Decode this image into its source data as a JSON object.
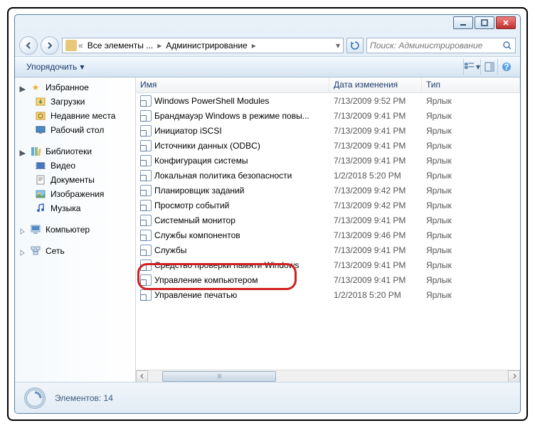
{
  "breadcrumb": {
    "segment1": "Все элементы ...",
    "segment2": "Администрирование"
  },
  "search": {
    "placeholder": "Поиск: Администрирование"
  },
  "toolbar": {
    "organize": "Упорядочить"
  },
  "sidebar": {
    "favorites": {
      "label": "Избранное",
      "items": [
        "Загрузки",
        "Недавние места",
        "Рабочий стол"
      ]
    },
    "libraries": {
      "label": "Библиотеки",
      "items": [
        "Видео",
        "Документы",
        "Изображения",
        "Музыка"
      ]
    },
    "computer": {
      "label": "Компьютер"
    },
    "network": {
      "label": "Сеть"
    }
  },
  "columns": {
    "name": "Имя",
    "date": "Дата изменения",
    "type": "Тип"
  },
  "files": [
    {
      "name": "Windows PowerShell Modules",
      "date": "7/13/2009 9:52 PM",
      "type": "Ярлык"
    },
    {
      "name": "Брандмауэр Windows в режиме повы...",
      "date": "7/13/2009 9:41 PM",
      "type": "Ярлык"
    },
    {
      "name": "Инициатор iSCSI",
      "date": "7/13/2009 9:41 PM",
      "type": "Ярлык"
    },
    {
      "name": "Источники данных (ODBC)",
      "date": "7/13/2009 9:41 PM",
      "type": "Ярлык"
    },
    {
      "name": "Конфигурация системы",
      "date": "7/13/2009 9:41 PM",
      "type": "Ярлык"
    },
    {
      "name": "Локальная политика безопасности",
      "date": "1/2/2018 5:20 PM",
      "type": "Ярлык"
    },
    {
      "name": "Планировщик заданий",
      "date": "7/13/2009 9:42 PM",
      "type": "Ярлык"
    },
    {
      "name": "Просмотр событий",
      "date": "7/13/2009 9:42 PM",
      "type": "Ярлык"
    },
    {
      "name": "Системный монитор",
      "date": "7/13/2009 9:41 PM",
      "type": "Ярлык"
    },
    {
      "name": "Службы компонентов",
      "date": "7/13/2009 9:46 PM",
      "type": "Ярлык"
    },
    {
      "name": "Службы",
      "date": "7/13/2009 9:41 PM",
      "type": "Ярлык"
    },
    {
      "name": "Средство проверки памяти Windows",
      "date": "7/13/2009 9:41 PM",
      "type": "Ярлык"
    },
    {
      "name": "Управление компьютером",
      "date": "7/13/2009 9:41 PM",
      "type": "Ярлык"
    },
    {
      "name": "Управление печатью",
      "date": "1/2/2018 5:20 PM",
      "type": "Ярлык"
    }
  ],
  "status": {
    "text": "Элементов: 14"
  }
}
